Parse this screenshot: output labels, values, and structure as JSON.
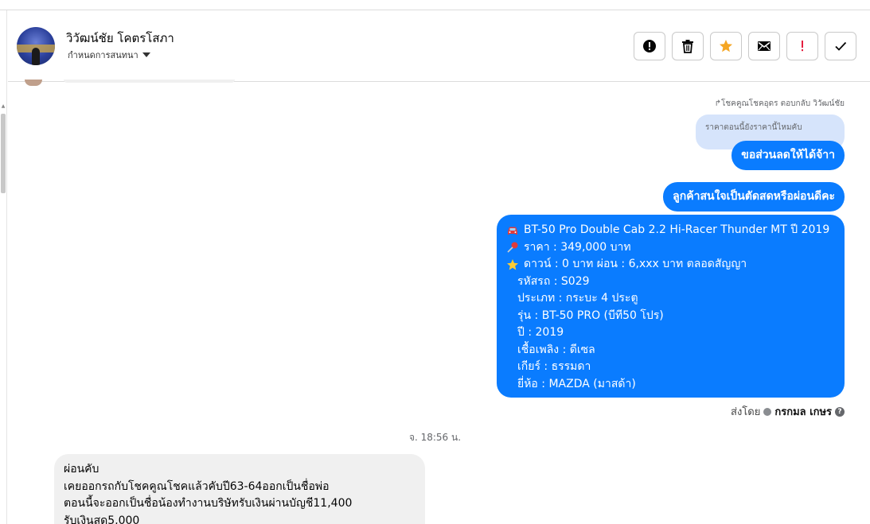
{
  "header": {
    "contact_name": "วิวัฒน์ชัย โคตรโสภา",
    "assign_label": "กำหนดการสนทนา"
  },
  "actions": [
    {
      "name": "report-icon",
      "color": "#050505"
    },
    {
      "name": "trash-icon",
      "color": "#050505"
    },
    {
      "name": "star-icon",
      "color": "#f5a623"
    },
    {
      "name": "envelope-icon",
      "color": "#050505"
    },
    {
      "name": "exclamation-icon",
      "color": "#e41e3f"
    },
    {
      "name": "check-icon",
      "color": "#050505"
    }
  ],
  "thread": {
    "reply_note": "↱โชคคูณโชคอุดร ตอบกลับ วิวัฒน์ชัย",
    "quoted_text": "ราคาตอนนี้ยังราคานี้ไหมคับ",
    "outgoing": [
      "ขอส่วนลดให้ได้จ้าา",
      "ลูกค้าสนใจเป็นตัดสดหรือผ่อนดีคะ"
    ],
    "listing": {
      "lines": [
        "BT-50 Pro Double Cab 2.2 Hi-Racer Thunder MT ปี 2019",
        "ราคา : 349,000 บาท",
        "ดาวน์ : 0 บาท ผ่อน : 6,xxx บาท ตลอดสัญญา",
        "รหัสรถ : S029",
        "ประเภท : กระบะ 4 ประตู",
        "รุ่น : BT-50 PRO (บีที50 โปร)",
        "ปี : 2019",
        "เชื้อเพลิง : ดีเซล",
        "เกียร์ : ธรรมดา",
        "ยี่ห้อ : MAZDA (มาสด้า)"
      ],
      "icons": [
        "car-icon",
        "pushpin-icon",
        "star-icon"
      ]
    },
    "sent_by_label": "ส่งโดย",
    "agent_name": "กรกมล เกษร",
    "timestamp": "จ. 18:56 น.",
    "incoming_lines": [
      "ผ่อนคับ",
      "เคยออกรถกับโชคคูณโชคแล้วคับปี63-64ออกเป็นชื่อพ่อ",
      "ตอนนี้จะออกเป็นชื่อน้องทำงานบริษัทรับเงินผ่านบัญชี11,400",
      "รับเงินสด5,000"
    ]
  },
  "colors": {
    "outgoing_bubble": "#0a7cff",
    "quoted_bubble": "#d6e4fb",
    "incoming_bubble": "#f0f0f0"
  }
}
